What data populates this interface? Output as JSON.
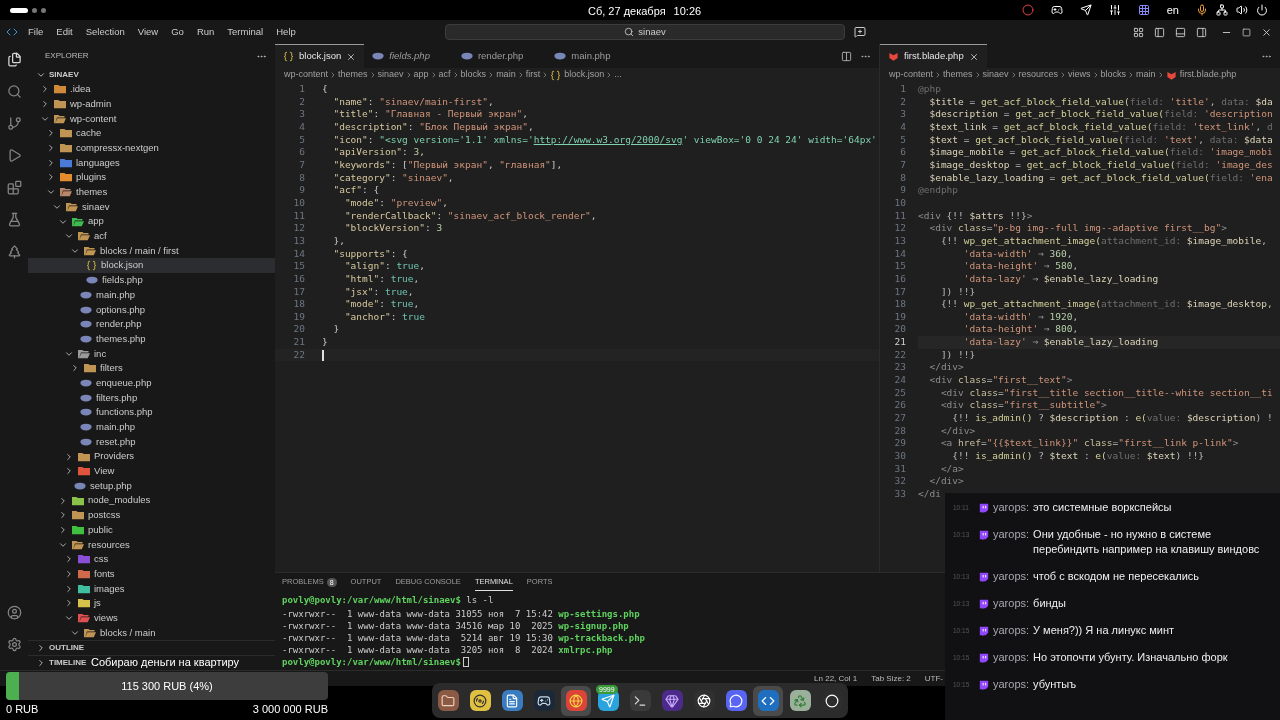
{
  "system_bar": {
    "date": "Сб, 27 декабря",
    "time": "10:26",
    "language": "en"
  },
  "title_bar": {
    "menu": [
      "File",
      "Edit",
      "Selection",
      "View",
      "Go",
      "Run",
      "Terminal",
      "Help"
    ],
    "search": "sinaev"
  },
  "sidebar": {
    "title": "EXPLORER",
    "root": "SINAEV",
    "tree": [
      {
        "label": ".idea",
        "kind": "folder",
        "color": "#d08a3a",
        "expanded": false,
        "selected": false
      },
      {
        "label": "wp-admin",
        "kind": "folder",
        "color": "#c09553",
        "expanded": false,
        "selected": false
      },
      {
        "label": "wp-content",
        "kind": "folder",
        "color": "#c09553",
        "expanded": true,
        "selected": false,
        "children": [
          {
            "label": "cache",
            "kind": "folder",
            "color": "#c09553",
            "expanded": false,
            "selected": false
          },
          {
            "label": "compressx-nextgen",
            "kind": "folder",
            "color": "#c09553",
            "expanded": false,
            "selected": false
          },
          {
            "label": "languages",
            "kind": "folder",
            "color": "#4b7bd8",
            "expanded": false,
            "selected": false
          },
          {
            "label": "plugins",
            "kind": "folder",
            "color": "#e68a2e",
            "expanded": false,
            "selected": false
          },
          {
            "label": "themes",
            "kind": "folder",
            "color": "#b8866a",
            "expanded": true,
            "selected": false,
            "children": [
              {
                "label": "sinaev",
                "kind": "folder",
                "color": "#c09553",
                "expanded": true,
                "selected": false,
                "children": [
                  {
                    "label": "app",
                    "kind": "folder",
                    "color": "#3fb950",
                    "expanded": true,
                    "selected": false,
                    "children": [
                      {
                        "label": "acf",
                        "kind": "folder",
                        "color": "#c09553",
                        "expanded": true,
                        "selected": false,
                        "children": [
                          {
                            "label": "blocks / main / first",
                            "kind": "folder",
                            "color": "#c09553",
                            "expanded": true,
                            "selected": false,
                            "children": [
                              {
                                "label": "block.json",
                                "kind": "json",
                                "selected": true
                              },
                              {
                                "label": "fields.php",
                                "kind": "php",
                                "selected": false
                              }
                            ]
                          },
                          {
                            "label": "main.php",
                            "kind": "php",
                            "selected": false
                          },
                          {
                            "label": "options.php",
                            "kind": "php",
                            "selected": false
                          },
                          {
                            "label": "render.php",
                            "kind": "php",
                            "selected": false
                          },
                          {
                            "label": "themes.php",
                            "kind": "php",
                            "selected": false
                          }
                        ]
                      },
                      {
                        "label": "inc",
                        "kind": "folder",
                        "color": "#9a9a9a",
                        "expanded": true,
                        "selected": false,
                        "children": [
                          {
                            "label": "filters",
                            "kind": "folder",
                            "color": "#c09553",
                            "expanded": false,
                            "selected": false
                          },
                          {
                            "label": "enqueue.php",
                            "kind": "php",
                            "selected": false
                          },
                          {
                            "label": "filters.php",
                            "kind": "php",
                            "selected": false
                          },
                          {
                            "label": "functions.php",
                            "kind": "php",
                            "selected": false
                          },
                          {
                            "label": "main.php",
                            "kind": "php",
                            "selected": false
                          },
                          {
                            "label": "reset.php",
                            "kind": "php",
                            "selected": false
                          }
                        ]
                      },
                      {
                        "label": "Providers",
                        "kind": "folder",
                        "color": "#c09553",
                        "expanded": false,
                        "selected": false
                      },
                      {
                        "label": "View",
                        "kind": "folder",
                        "color": "#e0533c",
                        "expanded": false,
                        "selected": false
                      },
                      {
                        "label": "setup.php",
                        "kind": "php",
                        "selected": false
                      }
                    ]
                  },
                  {
                    "label": "node_modules",
                    "kind": "folder",
                    "color": "#8bc34a",
                    "expanded": false,
                    "selected": false
                  },
                  {
                    "label": "postcss",
                    "kind": "folder",
                    "color": "#c09553",
                    "expanded": false,
                    "selected": false
                  },
                  {
                    "label": "public",
                    "kind": "folder",
                    "color": "#3fc13f",
                    "expanded": false,
                    "selected": false
                  },
                  {
                    "label": "resources",
                    "kind": "folder",
                    "color": "#c09553",
                    "expanded": true,
                    "selected": false,
                    "children": [
                      {
                        "label": "css",
                        "kind": "folder",
                        "color": "#8a4fd6",
                        "expanded": false,
                        "selected": false
                      },
                      {
                        "label": "fonts",
                        "kind": "folder",
                        "color": "#d06a4a",
                        "expanded": false,
                        "selected": false
                      },
                      {
                        "label": "images",
                        "kind": "folder",
                        "color": "#3fbf9f",
                        "expanded": false,
                        "selected": false
                      },
                      {
                        "label": "js",
                        "kind": "folder",
                        "color": "#d6c24a",
                        "expanded": false,
                        "selected": false
                      },
                      {
                        "label": "views",
                        "kind": "folder",
                        "color": "#e05050",
                        "expanded": true,
                        "selected": false,
                        "children": [
                          {
                            "label": "blocks / main",
                            "kind": "folder",
                            "color": "#c09553",
                            "expanded": true,
                            "selected": false
                          }
                        ]
                      }
                    ]
                  }
                ]
              }
            ]
          }
        ]
      }
    ],
    "sections": [
      {
        "label": "OUTLINE",
        "expanded": false
      },
      {
        "label": "TIMELINE",
        "expanded": false
      }
    ]
  },
  "editor_left": {
    "tabs": [
      {
        "label": "block.json",
        "kind": "json",
        "selected": true,
        "preview": false
      },
      {
        "label": "fields.php",
        "kind": "php",
        "selected": false,
        "preview": true
      },
      {
        "label": "render.php",
        "kind": "php",
        "selected": false,
        "preview": false
      },
      {
        "label": "main.php",
        "kind": "php",
        "selected": false,
        "preview": false
      }
    ],
    "breadcrumbs": [
      {
        "label": "wp-content",
        "kind": "folder"
      },
      {
        "label": "themes",
        "kind": "folder"
      },
      {
        "label": "sinaev",
        "kind": "folder"
      },
      {
        "label": "app",
        "kind": "folder"
      },
      {
        "label": "acf",
        "kind": "folder"
      },
      {
        "label": "blocks",
        "kind": "folder"
      },
      {
        "label": "main",
        "kind": "folder"
      },
      {
        "label": "first",
        "kind": "folder"
      },
      {
        "label": "block.json",
        "kind": "json"
      },
      {
        "label": "...",
        "kind": "more"
      }
    ],
    "lines": [
      {
        "number": "1",
        "current": false,
        "cursor": false,
        "tokens": [
          {
            "kind": "punct",
            "text": "{"
          }
        ]
      },
      {
        "number": "2",
        "current": false,
        "cursor": false,
        "tokens": [
          {
            "kind": "key",
            "text": "  \"name\""
          },
          {
            "kind": "punct",
            "text": ": "
          },
          {
            "kind": "string",
            "text": "\"sinaev/main-first\""
          },
          {
            "kind": "punct",
            "text": ","
          }
        ]
      },
      {
        "number": "3",
        "current": false,
        "cursor": false,
        "tokens": [
          {
            "kind": "key",
            "text": "  \"title\""
          },
          {
            "kind": "punct",
            "text": ": "
          },
          {
            "kind": "string",
            "text": "\"Главная - Первый экран\""
          },
          {
            "kind": "punct",
            "text": ","
          }
        ]
      },
      {
        "number": "4",
        "current": false,
        "cursor": false,
        "tokens": [
          {
            "kind": "key",
            "text": "  \"description\""
          },
          {
            "kind": "punct",
            "text": ": "
          },
          {
            "kind": "string",
            "text": "\"Блок Первый экран\""
          },
          {
            "kind": "punct",
            "text": ","
          }
        ]
      },
      {
        "number": "5",
        "current": false,
        "cursor": false,
        "tokens": [
          {
            "kind": "key",
            "text": "  \"icon\""
          },
          {
            "kind": "punct",
            "text": ": "
          },
          {
            "kind": "green",
            "text": "\"<svg version='1.1' xmlns='"
          },
          {
            "kind": "link",
            "text": "http://www.w3.org/2000/svg"
          },
          {
            "kind": "green",
            "text": "' viewBox='0 0 24 24' width='64px'"
          }
        ]
      },
      {
        "number": "6",
        "current": false,
        "cursor": false,
        "tokens": [
          {
            "kind": "key",
            "text": "  \"apiVersion\""
          },
          {
            "kind": "punct",
            "text": ": "
          },
          {
            "kind": "number",
            "text": "3"
          },
          {
            "kind": "punct",
            "text": ","
          }
        ]
      },
      {
        "number": "7",
        "current": false,
        "cursor": false,
        "tokens": [
          {
            "kind": "key",
            "text": "  \"keywords\""
          },
          {
            "kind": "punct",
            "text": ": ["
          },
          {
            "kind": "string",
            "text": "\"Первый экран\""
          },
          {
            "kind": "punct",
            "text": ", "
          },
          {
            "kind": "string",
            "text": "\"главная\""
          },
          {
            "kind": "punct",
            "text": "],"
          }
        ]
      },
      {
        "number": "8",
        "current": false,
        "cursor": false,
        "tokens": [
          {
            "kind": "key",
            "text": "  \"category\""
          },
          {
            "kind": "punct",
            "text": ": "
          },
          {
            "kind": "string",
            "text": "\"sinaev\""
          },
          {
            "kind": "punct",
            "text": ","
          }
        ]
      },
      {
        "number": "9",
        "current": false,
        "cursor": false,
        "tokens": [
          {
            "kind": "key",
            "text": "  \"acf\""
          },
          {
            "kind": "punct",
            "text": ": {"
          }
        ]
      },
      {
        "number": "10",
        "current": false,
        "cursor": false,
        "tokens": [
          {
            "kind": "key",
            "text": "    \"mode\""
          },
          {
            "kind": "punct",
            "text": ": "
          },
          {
            "kind": "string",
            "text": "\"preview\""
          },
          {
            "kind": "punct",
            "text": ","
          }
        ]
      },
      {
        "number": "11",
        "current": false,
        "cursor": false,
        "tokens": [
          {
            "kind": "key",
            "text": "    \"renderCallback\""
          },
          {
            "kind": "punct",
            "text": ": "
          },
          {
            "kind": "string",
            "text": "\"sinaev_acf_block_render\""
          },
          {
            "kind": "punct",
            "text": ","
          }
        ]
      },
      {
        "number": "12",
        "current": false,
        "cursor": false,
        "tokens": [
          {
            "kind": "key",
            "text": "    \"blockVersion\""
          },
          {
            "kind": "punct",
            "text": ": "
          },
          {
            "kind": "number",
            "text": "3"
          }
        ]
      },
      {
        "number": "13",
        "current": false,
        "cursor": false,
        "tokens": [
          {
            "kind": "punct",
            "text": "  },"
          }
        ]
      },
      {
        "number": "14",
        "current": false,
        "cursor": false,
        "tokens": [
          {
            "kind": "key",
            "text": "  \"supports\""
          },
          {
            "kind": "punct",
            "text": ": {"
          }
        ]
      },
      {
        "number": "15",
        "current": false,
        "cursor": false,
        "tokens": [
          {
            "kind": "key",
            "text": "    \"align\""
          },
          {
            "kind": "punct",
            "text": ": "
          },
          {
            "kind": "bool",
            "text": "true"
          },
          {
            "kind": "punct",
            "text": ","
          }
        ]
      },
      {
        "number": "16",
        "current": false,
        "cursor": false,
        "tokens": [
          {
            "kind": "key",
            "text": "    \"html\""
          },
          {
            "kind": "punct",
            "text": ": "
          },
          {
            "kind": "bool",
            "text": "true"
          },
          {
            "kind": "punct",
            "text": ","
          }
        ]
      },
      {
        "number": "17",
        "current": false,
        "cursor": false,
        "tokens": [
          {
            "kind": "key",
            "text": "    \"jsx\""
          },
          {
            "kind": "punct",
            "text": ": "
          },
          {
            "kind": "bool",
            "text": "true"
          },
          {
            "kind": "punct",
            "text": ","
          }
        ]
      },
      {
        "number": "18",
        "current": false,
        "cursor": false,
        "tokens": [
          {
            "kind": "key",
            "text": "    \"mode\""
          },
          {
            "kind": "punct",
            "text": ": "
          },
          {
            "kind": "bool",
            "text": "true"
          },
          {
            "kind": "punct",
            "text": ","
          }
        ]
      },
      {
        "number": "19",
        "current": false,
        "cursor": false,
        "tokens": [
          {
            "kind": "key",
            "text": "    \"anchor\""
          },
          {
            "kind": "punct",
            "text": ": "
          },
          {
            "kind": "bool",
            "text": "true"
          }
        ]
      },
      {
        "number": "20",
        "current": false,
        "cursor": false,
        "tokens": [
          {
            "kind": "punct",
            "text": "  }"
          }
        ]
      },
      {
        "number": "21",
        "current": false,
        "cursor": false,
        "tokens": [
          {
            "kind": "punct",
            "text": "}"
          }
        ]
      },
      {
        "number": "22",
        "current": false,
        "cursor": true
      }
    ]
  },
  "editor_right": {
    "tabs": [
      {
        "label": "first.blade.php",
        "kind": "blade",
        "selected": true,
        "preview": false
      }
    ],
    "breadcrumbs": [
      {
        "label": "wp-content",
        "kind": "folder"
      },
      {
        "label": "themes",
        "kind": "folder"
      },
      {
        "label": "sinaev",
        "kind": "folder"
      },
      {
        "label": "resources",
        "kind": "folder"
      },
      {
        "label": "views",
        "kind": "folder"
      },
      {
        "label": "blocks",
        "kind": "folder"
      },
      {
        "label": "main",
        "kind": "folder"
      },
      {
        "label": "first.blade.php",
        "kind": "blade"
      }
    ],
    "lines": [
      {
        "number": "1",
        "current": false,
        "cursor": false,
        "tokens": [
          {
            "kind": "dim",
            "text": "@php"
          }
        ]
      },
      {
        "number": "2",
        "current": false,
        "cursor": false,
        "tokens": [
          {
            "kind": "var",
            "text": "  $title"
          },
          {
            "kind": "plain",
            "text": " = "
          },
          {
            "kind": "func",
            "text": "get_acf_block_field_value("
          },
          {
            "kind": "dim",
            "text": "field: "
          },
          {
            "kind": "string",
            "text": "'title'"
          },
          {
            "kind": "plain",
            "text": ", "
          },
          {
            "kind": "dim",
            "text": "data: "
          },
          {
            "kind": "var",
            "text": "$da"
          }
        ]
      },
      {
        "number": "3",
        "current": false,
        "cursor": false,
        "tokens": [
          {
            "kind": "var",
            "text": "  $description"
          },
          {
            "kind": "plain",
            "text": " = "
          },
          {
            "kind": "func",
            "text": "get_acf_block_field_value("
          },
          {
            "kind": "dim",
            "text": "field: "
          },
          {
            "kind": "string",
            "text": "'description"
          }
        ]
      },
      {
        "number": "4",
        "current": false,
        "cursor": false,
        "tokens": [
          {
            "kind": "var",
            "text": "  $text_link"
          },
          {
            "kind": "plain",
            "text": " = "
          },
          {
            "kind": "func",
            "text": "get_acf_block_field_value("
          },
          {
            "kind": "dim",
            "text": "field: "
          },
          {
            "kind": "string",
            "text": "'text_link'"
          },
          {
            "kind": "plain",
            "text": ", "
          },
          {
            "kind": "dim",
            "text": "d"
          }
        ]
      },
      {
        "number": "5",
        "current": false,
        "cursor": false,
        "tokens": [
          {
            "kind": "var",
            "text": "  $text"
          },
          {
            "kind": "plain",
            "text": " = "
          },
          {
            "kind": "func",
            "text": "get_acf_block_field_value("
          },
          {
            "kind": "dim",
            "text": "field: "
          },
          {
            "kind": "string",
            "text": "'text'"
          },
          {
            "kind": "plain",
            "text": ", "
          },
          {
            "kind": "dim",
            "text": "data: "
          },
          {
            "kind": "var",
            "text": "$data"
          }
        ]
      },
      {
        "number": "6",
        "current": false,
        "cursor": false,
        "tokens": [
          {
            "kind": "var",
            "text": "  $image_mobile"
          },
          {
            "kind": "plain",
            "text": " = "
          },
          {
            "kind": "func",
            "text": "get_acf_block_field_value("
          },
          {
            "kind": "dim",
            "text": "field: "
          },
          {
            "kind": "string",
            "text": "'image_mobi"
          }
        ]
      },
      {
        "number": "7",
        "current": false,
        "cursor": false,
        "tokens": [
          {
            "kind": "var",
            "text": "  $image_desktop"
          },
          {
            "kind": "plain",
            "text": " = "
          },
          {
            "kind": "func",
            "text": "get_acf_block_field_value("
          },
          {
            "kind": "dim",
            "text": "field: "
          },
          {
            "kind": "string",
            "text": "'image_des"
          }
        ]
      },
      {
        "number": "8",
        "current": false,
        "cursor": false,
        "tokens": [
          {
            "kind": "var",
            "text": "  $enable_lazy_loading"
          },
          {
            "kind": "plain",
            "text": " = "
          },
          {
            "kind": "func",
            "text": "get_acf_block_field_value("
          },
          {
            "kind": "dim",
            "text": "field: "
          },
          {
            "kind": "string",
            "text": "'ena"
          }
        ]
      },
      {
        "number": "9",
        "current": false,
        "cursor": false,
        "tokens": [
          {
            "kind": "dim",
            "text": "@endphp"
          }
        ]
      },
      {
        "number": "10",
        "current": false,
        "cursor": false
      },
      {
        "number": "11",
        "current": false,
        "cursor": false,
        "tokens": [
          {
            "kind": "tag",
            "text": "<div "
          },
          {
            "kind": "plain",
            "text": "{!! "
          },
          {
            "kind": "var",
            "text": "$attrs"
          },
          {
            "kind": "plain",
            "text": " !!}"
          },
          {
            "kind": "tag",
            "text": ">"
          }
        ]
      },
      {
        "number": "12",
        "current": false,
        "cursor": false,
        "tokens": [
          {
            "kind": "tag",
            "text": "  <div "
          },
          {
            "kind": "attr",
            "text": "class"
          },
          {
            "kind": "plain",
            "text": "="
          },
          {
            "kind": "string",
            "text": "\"p-bg img--full img--adaptive first__bg\""
          },
          {
            "kind": "tag",
            "text": ">"
          }
        ]
      },
      {
        "number": "13",
        "current": false,
        "cursor": false,
        "tokens": [
          {
            "kind": "plain",
            "text": "    {!! "
          },
          {
            "kind": "func",
            "text": "wp_get_attachment_image("
          },
          {
            "kind": "dim",
            "text": "attachment_id: "
          },
          {
            "kind": "var",
            "text": "$image_mobile"
          },
          {
            "kind": "plain",
            "text": ","
          }
        ]
      },
      {
        "number": "14",
        "current": false,
        "cursor": false,
        "tokens": [
          {
            "kind": "string",
            "text": "        'data-width'"
          },
          {
            "kind": "plain",
            "text": " ⇒ "
          },
          {
            "kind": "number",
            "text": "360"
          },
          {
            "kind": "plain",
            "text": ","
          }
        ]
      },
      {
        "number": "15",
        "current": false,
        "cursor": false,
        "tokens": [
          {
            "kind": "string",
            "text": "        'data-height'"
          },
          {
            "kind": "plain",
            "text": " ⇒ "
          },
          {
            "kind": "number",
            "text": "580"
          },
          {
            "kind": "plain",
            "text": ","
          }
        ]
      },
      {
        "number": "16",
        "current": false,
        "cursor": false,
        "tokens": [
          {
            "kind": "string",
            "text": "        'data-lazy'"
          },
          {
            "kind": "plain",
            "text": " ⇒ "
          },
          {
            "kind": "var",
            "text": "$enable_lazy_loading"
          }
        ]
      },
      {
        "number": "17",
        "current": false,
        "cursor": false,
        "tokens": [
          {
            "kind": "plain",
            "text": "    ]) !!}"
          }
        ]
      },
      {
        "number": "18",
        "current": false,
        "cursor": false,
        "tokens": [
          {
            "kind": "plain",
            "text": "    {!! "
          },
          {
            "kind": "func",
            "text": "wp_get_attachment_image("
          },
          {
            "kind": "dim",
            "text": "attachment_id: "
          },
          {
            "kind": "var",
            "text": "$image_desktop"
          },
          {
            "kind": "plain",
            "text": ","
          }
        ]
      },
      {
        "number": "19",
        "current": false,
        "cursor": false,
        "tokens": [
          {
            "kind": "string",
            "text": "        'data-width'"
          },
          {
            "kind": "plain",
            "text": " ⇒ "
          },
          {
            "kind": "number",
            "text": "1920"
          },
          {
            "kind": "plain",
            "text": ","
          }
        ]
      },
      {
        "number": "20",
        "current": false,
        "cursor": false,
        "tokens": [
          {
            "kind": "string",
            "text": "        'data-height'"
          },
          {
            "kind": "plain",
            "text": " ⇒ "
          },
          {
            "kind": "number",
            "text": "800"
          },
          {
            "kind": "plain",
            "text": ","
          }
        ]
      },
      {
        "number": "21",
        "current": true,
        "cursor": false,
        "tokens": [
          {
            "kind": "string",
            "text": "        'data-lazy'"
          },
          {
            "kind": "plain",
            "text": " ⇒ "
          },
          {
            "kind": "var",
            "text": "$enable_lazy_loading"
          }
        ]
      },
      {
        "number": "22",
        "current": false,
        "cursor": false,
        "tokens": [
          {
            "kind": "plain",
            "text": "    ]) !!}"
          }
        ]
      },
      {
        "number": "23",
        "current": false,
        "cursor": false,
        "tokens": [
          {
            "kind": "tag",
            "text": "  </div>"
          }
        ]
      },
      {
        "number": "24",
        "current": false,
        "cursor": false,
        "tokens": [
          {
            "kind": "tag",
            "text": "  <div "
          },
          {
            "kind": "attr",
            "text": "class"
          },
          {
            "kind": "plain",
            "text": "="
          },
          {
            "kind": "string",
            "text": "\"first__text\""
          },
          {
            "kind": "tag",
            "text": ">"
          }
        ]
      },
      {
        "number": "25",
        "current": false,
        "cursor": false,
        "tokens": [
          {
            "kind": "tag",
            "text": "    <div "
          },
          {
            "kind": "attr",
            "text": "class"
          },
          {
            "kind": "plain",
            "text": "="
          },
          {
            "kind": "string",
            "text": "\"first__title section__title--white section__ti"
          }
        ]
      },
      {
        "number": "26",
        "current": false,
        "cursor": false,
        "tokens": [
          {
            "kind": "tag",
            "text": "    <div "
          },
          {
            "kind": "attr",
            "text": "class"
          },
          {
            "kind": "plain",
            "text": "="
          },
          {
            "kind": "string",
            "text": "\"first__subtitle\""
          },
          {
            "kind": "tag",
            "text": ">"
          }
        ]
      },
      {
        "number": "27",
        "current": false,
        "cursor": false,
        "tokens": [
          {
            "kind": "plain",
            "text": "      {!! "
          },
          {
            "kind": "func",
            "text": "is_admin() "
          },
          {
            "kind": "plain",
            "text": "? "
          },
          {
            "kind": "var",
            "text": "$description"
          },
          {
            "kind": "plain",
            "text": " : "
          },
          {
            "kind": "func",
            "text": "e("
          },
          {
            "kind": "dim",
            "text": "value: "
          },
          {
            "kind": "var",
            "text": "$description"
          },
          {
            "kind": "plain",
            "text": ") !"
          }
        ]
      },
      {
        "number": "28",
        "current": false,
        "cursor": false,
        "tokens": [
          {
            "kind": "tag",
            "text": "    </div>"
          }
        ]
      },
      {
        "number": "29",
        "current": false,
        "cursor": false,
        "tokens": [
          {
            "kind": "tag",
            "text": "    <a "
          },
          {
            "kind": "attr",
            "text": "href"
          },
          {
            "kind": "plain",
            "text": "="
          },
          {
            "kind": "string",
            "text": "\"{{$text_link}}\""
          },
          {
            "kind": "attr",
            "text": " class"
          },
          {
            "kind": "plain",
            "text": "="
          },
          {
            "kind": "string",
            "text": "\"first__link p-link\""
          },
          {
            "kind": "tag",
            "text": ">"
          }
        ]
      },
      {
        "number": "30",
        "current": false,
        "cursor": false,
        "tokens": [
          {
            "kind": "plain",
            "text": "      {!! "
          },
          {
            "kind": "func",
            "text": "is_admin() "
          },
          {
            "kind": "plain",
            "text": "? "
          },
          {
            "kind": "var",
            "text": "$text"
          },
          {
            "kind": "plain",
            "text": " : "
          },
          {
            "kind": "func",
            "text": "e("
          },
          {
            "kind": "dim",
            "text": "value: "
          },
          {
            "kind": "var",
            "text": "$text"
          },
          {
            "kind": "plain",
            "text": ") !!}"
          }
        ]
      },
      {
        "number": "31",
        "current": false,
        "cursor": false,
        "tokens": [
          {
            "kind": "tag",
            "text": "    </a>"
          }
        ]
      },
      {
        "number": "32",
        "current": false,
        "cursor": false,
        "tokens": [
          {
            "kind": "tag",
            "text": "  </div>"
          }
        ]
      },
      {
        "number": "33",
        "current": false,
        "cursor": false,
        "tokens": [
          {
            "kind": "tag",
            "text": "</di"
          }
        ]
      }
    ]
  },
  "panel": {
    "tabs": [
      {
        "label": "PROBLEMS",
        "badge": "8",
        "selected": false
      },
      {
        "label": "OUTPUT",
        "selected": false
      },
      {
        "label": "DEBUG CONSOLE",
        "selected": false
      },
      {
        "label": "TERMINAL",
        "selected": true
      },
      {
        "label": "PORTS",
        "selected": false
      }
    ],
    "terminal": [
      {
        "kind": "command",
        "prompt": "povly@povly:/var/www/html/sinaev$",
        "text": " ls -l"
      },
      {
        "kind": "file",
        "text": "-rwxrwxr--  1 www-data www-data 31055 ноя  7 15:42 ",
        "name": "wp-settings.php"
      },
      {
        "kind": "file",
        "text": "-rwxrwxr--  1 www-data www-data 34516 мар 10  2025 ",
        "name": "wp-signup.php"
      },
      {
        "kind": "file",
        "text": "-rwxrwxr--  1 www-data www-data  5214 авг 19 15:30 ",
        "name": "wp-trackback.php"
      },
      {
        "kind": "file",
        "text": "-rwxrwxr--  1 www-data www-data  3205 ноя  8  2024 ",
        "name": "xmlrpc.php"
      },
      {
        "kind": "prompt",
        "prompt": "povly@povly:/var/www/html/sinaev$"
      }
    ]
  },
  "status_bar": [
    "Ln 22, Col 1",
    "Tab Size: 2",
    "UTF-"
  ],
  "donation": {
    "title": "Собираю деньги на квартиру",
    "level": 0.04,
    "reading": "115 300 RUB (4%)",
    "min": "0 RUB",
    "max": "3 000 000 RUB"
  },
  "dock": [
    {
      "kind": "files",
      "active": false
    },
    {
      "kind": "music",
      "active": false
    },
    {
      "kind": "document",
      "active": false
    },
    {
      "kind": "steam",
      "active": false
    },
    {
      "kind": "browser",
      "active": true
    },
    {
      "kind": "telegram",
      "active": false,
      "badge": "9999"
    },
    {
      "kind": "terminal",
      "active": false
    },
    {
      "kind": "obsidian",
      "active": false
    },
    {
      "kind": "obs",
      "active": false
    },
    {
      "kind": "discord",
      "active": false
    },
    {
      "kind": "vscode",
      "active": true
    },
    {
      "kind": "trash",
      "active": false
    },
    {
      "kind": "ubuntu",
      "active": false
    }
  ],
  "chat": [
    {
      "time": "10:11",
      "user": "yarops:",
      "text": "это системные воркспейсы"
    },
    {
      "time": "10:13",
      "user": "yarops:",
      "text": "Они удобные - но нужно в системе перебиндить например на клавишу виндовс"
    },
    {
      "time": "10:13",
      "user": "yarops:",
      "text": "чтоб с вскодом не пересекались"
    },
    {
      "time": "10:13",
      "user": "yarops:",
      "text": "бинды"
    },
    {
      "time": "10:15",
      "user": "yarops:",
      "text": "У меня?)) Я на линукс минт"
    },
    {
      "time": "10:15",
      "user": "yarops:",
      "text": "Но этопочти убунту. Изначально форк"
    },
    {
      "time": "10:15",
      "user": "yarops:",
      "text": "убунтыъ"
    }
  ]
}
